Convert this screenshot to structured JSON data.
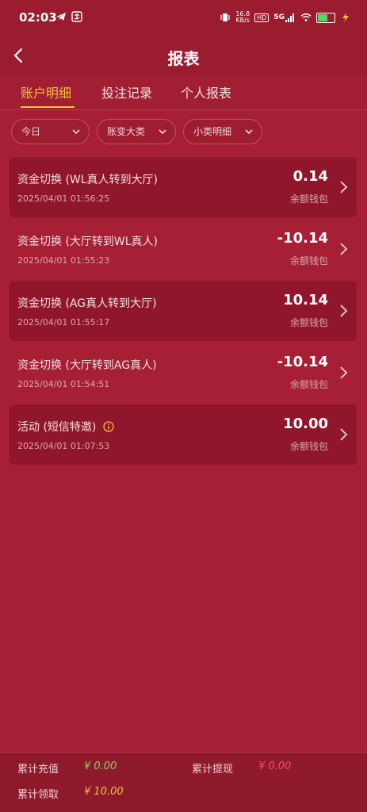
{
  "status_bar": {
    "time": "02:03",
    "net_speed_top": "16.8",
    "net_speed_bottom": "KB/s",
    "hd_badge": "HD",
    "signal": "5G"
  },
  "header": {
    "title": "报表"
  },
  "tabs": [
    {
      "label": "账户明细",
      "active": true
    },
    {
      "label": "投注记录",
      "active": false
    },
    {
      "label": "个人报表",
      "active": false
    }
  ],
  "filters": [
    {
      "label": "今日"
    },
    {
      "label": "账变大类"
    },
    {
      "label": "小类明细"
    }
  ],
  "records": [
    {
      "title": "资金切换 (WL真人转到大厅)",
      "time": "2025/04/01 01:56:25",
      "amount": "0.14",
      "wallet": "余额钱包"
    },
    {
      "title": "资金切换 (大厅转到WL真人)",
      "time": "2025/04/01 01:55:23",
      "amount": "-10.14",
      "wallet": "余额钱包"
    },
    {
      "title": "资金切换 (AG真人转到大厅)",
      "time": "2025/04/01 01:55:17",
      "amount": "10.14",
      "wallet": "余额钱包"
    },
    {
      "title": "资金切换 (大厅转到AG真人)",
      "time": "2025/04/01 01:54:51",
      "amount": "-10.14",
      "wallet": "余额钱包"
    },
    {
      "title": "活动 (短信特邀)",
      "time": "2025/04/01 01:07:53",
      "amount": "10.00",
      "wallet": "余额钱包"
    }
  ],
  "footer": {
    "total_deposit_label": "累计充值",
    "total_deposit_value": "¥ 0.00",
    "total_withdraw_label": "累计提现",
    "total_withdraw_value": "¥ 0.00",
    "total_received_label": "累计领取",
    "total_received_value": "¥ 10.00"
  },
  "colors": {
    "accent": "#f2c23c",
    "deposit_value": "#8fd14f",
    "withdraw_value": "#ff4a5a",
    "received_value": "#f2c23c"
  }
}
